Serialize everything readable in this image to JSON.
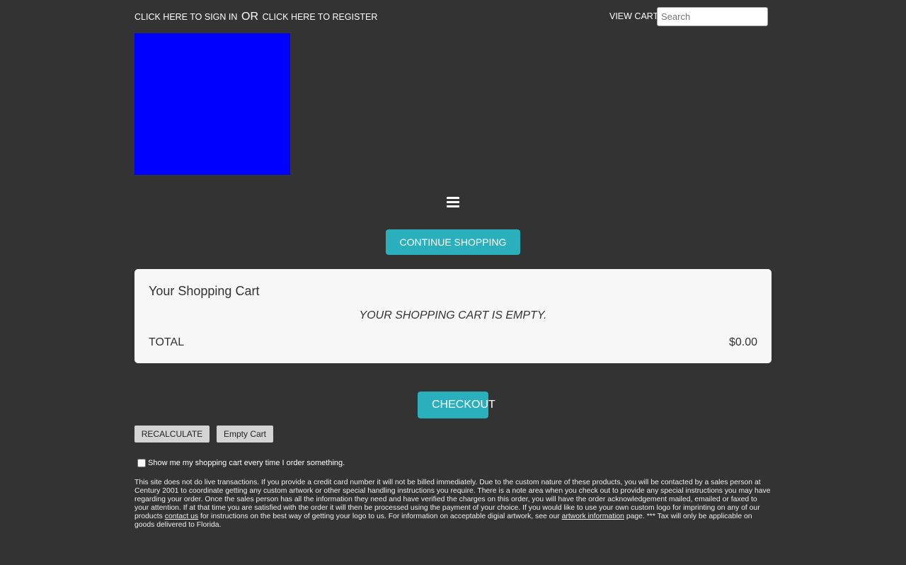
{
  "header": {
    "sign_in_label": "CLICK HERE TO SIGN IN",
    "or_label": "OR",
    "register_label": "CLICK HERE TO REGISTER",
    "view_cart_label": "VIEW CART",
    "search_placeholder": "Search"
  },
  "logo": {
    "color": "#0000ff"
  },
  "nav": {
    "menu_icon": "hamburger-menu-icon"
  },
  "buttons": {
    "continue_shopping": "CONTINUE SHOPPING",
    "checkout": "CHECKOUT",
    "recalculate": "RECALCULATE",
    "empty_cart": "Empty Cart"
  },
  "cart": {
    "title": "Your Shopping Cart",
    "empty_message": "YOUR SHOPPING CART IS EMPTY.",
    "total_label": "TOTAL",
    "total_value": "$0.00"
  },
  "preferences": {
    "show_cart_label": "Show me my shopping cart every time I order something.",
    "show_cart_checked": false
  },
  "notice": {
    "text_1": "This site does not do live transactions. If you provide a credit card number it will not be billed immediately. Due to the custom nature of these products, you will be contacted by a sales person at Century 2001 to coordinate getting any custom artwork or other special handling instructions you require. There is a note area when you check out to provide any special instructions you may have regarding your order. Once the sales person has all the information they need and have verified the charges on this order, you will have the order acknowledgement mailed, emailed or faxed to your attention. If at that time you are satisfied with the order it will then be processed using the payment of your choice. If you would like to use your own custom logo for imprinting on any of our products ",
    "contact_link": "contact us",
    "text_2": " for instructions on the best way of getting your logo to us. For information on acceptable digial artwork, see our ",
    "artwork_link": "artwork information",
    "text_3": " page. *** Tax will only be applicable on goods delivered to Florida."
  },
  "colors": {
    "background": "#333333",
    "accent": "#2ab0bd",
    "panel": "#f7f7f7"
  }
}
